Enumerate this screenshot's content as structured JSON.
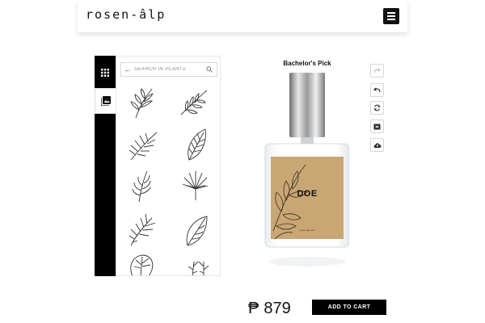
{
  "header": {
    "brand": "rosen-âlp"
  },
  "sidebar": {
    "apps_icon": "apps-grid-icon",
    "gallery_icon": "image-gallery-icon"
  },
  "panel": {
    "back_label": "←",
    "search_placeholder": "SEARCH IN PLANTS",
    "plants": [
      "fern-branch-1",
      "leaf-branch-2",
      "palm-frond-3",
      "striped-leaf-4",
      "sprig-5",
      "fan-palm-6",
      "twig-7",
      "single-leaf-8",
      "monstera-9",
      "small-sprig-10"
    ]
  },
  "product": {
    "title": "Bachelor's Pick",
    "label_name": "DOE",
    "label_sub": "rosen-alp.com"
  },
  "tools": [
    "redo-icon",
    "undo-icon",
    "refresh-icon",
    "toggle-icon",
    "cloud-upload-icon"
  ],
  "purchase": {
    "currency": "₱",
    "price": "879",
    "cart_label": "ADD TO CART"
  }
}
